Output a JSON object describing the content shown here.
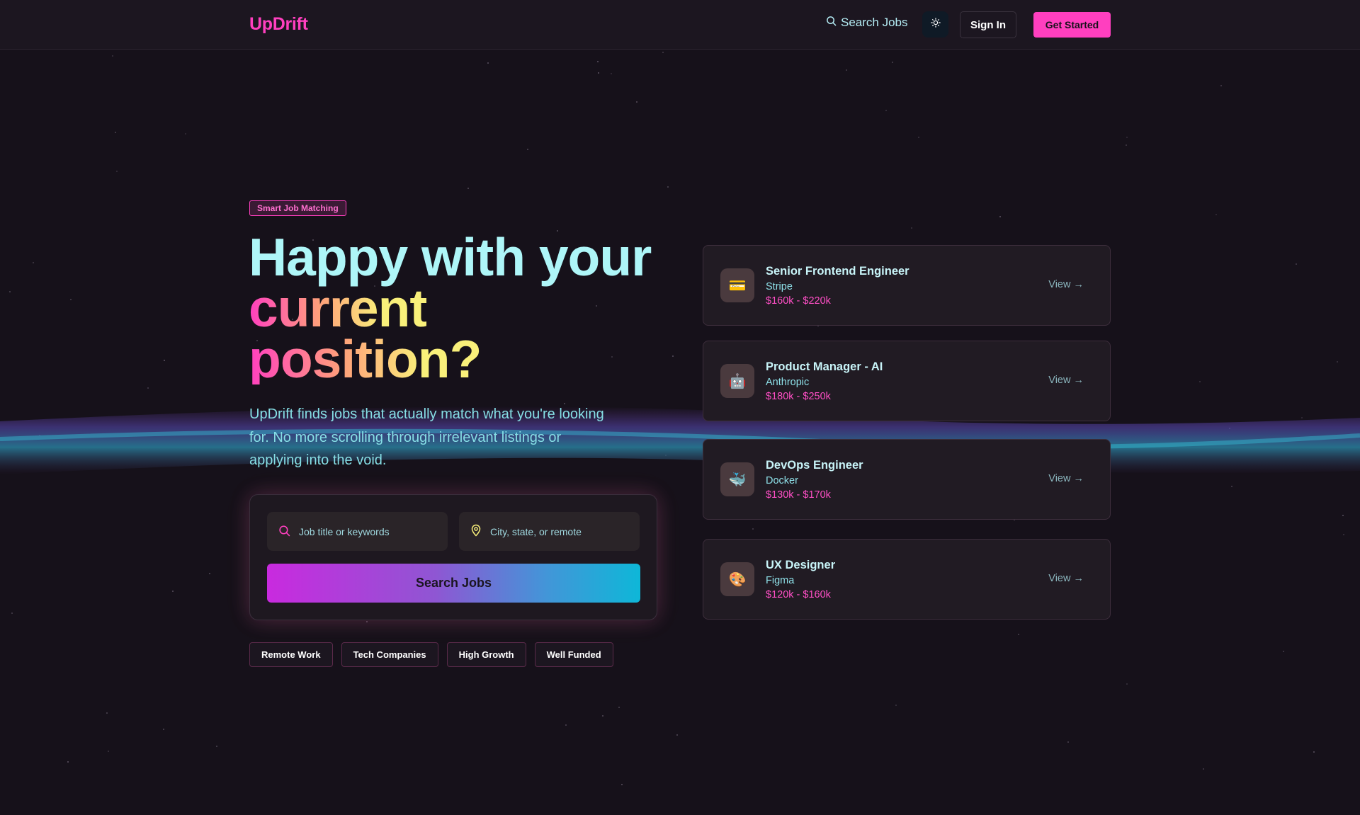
{
  "nav": {
    "logo": "UpDrift",
    "search_label": "Search Jobs",
    "search_icon": "search-icon",
    "theme_icon": "sun-icon",
    "signin_label": "Sign In",
    "get_started_label": "Get Started"
  },
  "hero": {
    "badge": "Smart Job Matching",
    "headline_line1": "Happy with your",
    "headline_line2": "current",
    "headline_line3": "position?",
    "subtext": "UpDrift finds jobs that actually match what you're looking for. No more scrolling through irrelevant listings or applying into the void."
  },
  "search": {
    "keyword_placeholder": "Job title or keywords",
    "location_placeholder": "City, state, or remote",
    "keyword_icon": "search-icon",
    "location_icon": "map-pin-icon",
    "button_label": "Search Jobs"
  },
  "tags": [
    "Remote Work",
    "Tech Companies",
    "High Growth",
    "Well Funded"
  ],
  "jobs": [
    {
      "title": "Senior Frontend Engineer",
      "company": "Stripe",
      "salary": "$160k - $220k",
      "icon": "💳",
      "icon_name": "credit-card-icon",
      "view": "View →"
    },
    {
      "title": "Product Manager - AI",
      "company": "Anthropic",
      "salary": "$180k - $250k",
      "icon": "🤖",
      "icon_name": "robot-icon",
      "view": "View →"
    },
    {
      "title": "DevOps Engineer",
      "company": "Docker",
      "salary": "$130k - $170k",
      "icon": "🐳",
      "icon_name": "whale-icon",
      "view": "View →"
    },
    {
      "title": "UX Designer",
      "company": "Figma",
      "salary": "$120k - $160k",
      "icon": "🎨",
      "icon_name": "palette-icon",
      "view": "View →"
    }
  ],
  "colors": {
    "background": "#16111a",
    "brand_pink": "#ff3fbf",
    "cyan": "#aef6f8",
    "yellow": "#f9f07a"
  }
}
